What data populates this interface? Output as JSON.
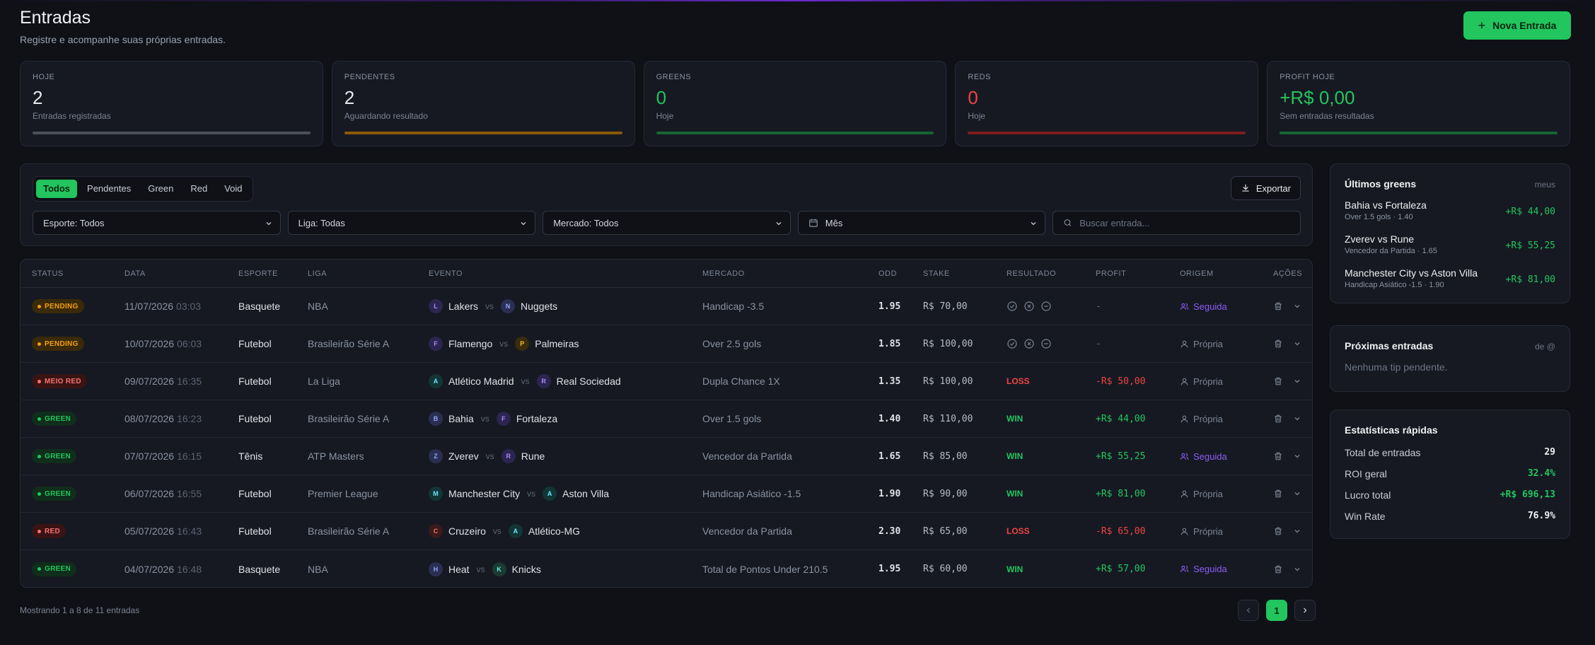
{
  "header": {
    "title": "Entradas",
    "subtitle": "Registre e acompanhe suas próprias entradas.",
    "new_button": "Nova Entrada"
  },
  "stats": [
    {
      "label": "HOJE",
      "value": "2",
      "sub": "Entradas registradas",
      "color": "#e6e8ee",
      "bar": "#4b4f5a"
    },
    {
      "label": "PENDENTES",
      "value": "2",
      "sub": "Aguardando resultado",
      "color": "#e6e8ee",
      "bar": "#8a5a08"
    },
    {
      "label": "GREENS",
      "value": "0",
      "sub": "Hoje",
      "color": "#22c55e",
      "bar": "#166534"
    },
    {
      "label": "REDS",
      "value": "0",
      "sub": "Hoje",
      "color": "#ef4444",
      "bar": "#7f1d1d"
    },
    {
      "label": "PROFIT HOJE",
      "value": "+R$ 0,00",
      "sub": "Sem entradas resultadas",
      "color": "#22c55e",
      "bar": "#166534"
    }
  ],
  "filters": {
    "tabs": [
      "Todos",
      "Pendentes",
      "Green",
      "Red",
      "Void"
    ],
    "active_tab": 0,
    "export_label": "Exportar",
    "sport": "Esporte: Todos",
    "league": "Liga: Todas",
    "market": "Mercado: Todos",
    "period": "Mês",
    "search_placeholder": "Buscar entrada..."
  },
  "table": {
    "headers": [
      "STATUS",
      "DATA",
      "ESPORTE",
      "LIGA",
      "EVENTO",
      "MERCADO",
      "ODD",
      "STAKE",
      "RESULTADO",
      "PROFIT",
      "ORIGEM",
      "AÇÕES"
    ],
    "rows": [
      {
        "status": "PENDING",
        "date": "11/07/2026",
        "time": "03:03",
        "sport": "Basquete",
        "league": "NBA",
        "home": "Lakers",
        "home_initial": "L",
        "away": "Nuggets",
        "away_initial": "N",
        "market": "Handicap -3.5",
        "odd": "1.95",
        "stake": "R$ 70,00",
        "result": "",
        "profit": "-",
        "origin": "Seguida"
      },
      {
        "status": "PENDING",
        "date": "10/07/2026",
        "time": "06:03",
        "sport": "Futebol",
        "league": "Brasileirão Série A",
        "home": "Flamengo",
        "home_initial": "F",
        "away": "Palmeiras",
        "away_initial": "P",
        "market": "Over 2.5 gols",
        "odd": "1.85",
        "stake": "R$ 100,00",
        "result": "",
        "profit": "-",
        "origin": "Própria"
      },
      {
        "status": "MEIO RED",
        "date": "09/07/2026",
        "time": "16:35",
        "sport": "Futebol",
        "league": "La Liga",
        "home": "Atlético Madrid",
        "home_initial": "A",
        "away": "Real Sociedad",
        "away_initial": "R",
        "market": "Dupla Chance 1X",
        "odd": "1.35",
        "stake": "R$ 100,00",
        "result": "LOSS",
        "profit": "-R$ 50,00",
        "origin": "Própria"
      },
      {
        "status": "GREEN",
        "date": "08/07/2026",
        "time": "16:23",
        "sport": "Futebol",
        "league": "Brasileirão Série A",
        "home": "Bahia",
        "home_initial": "B",
        "away": "Fortaleza",
        "away_initial": "F",
        "market": "Over 1.5 gols",
        "odd": "1.40",
        "stake": "R$ 110,00",
        "result": "WIN",
        "profit": "+R$ 44,00",
        "origin": "Própria"
      },
      {
        "status": "GREEN",
        "date": "07/07/2026",
        "time": "16:15",
        "sport": "Tênis",
        "league": "ATP Masters",
        "home": "Zverev",
        "home_initial": "Z",
        "away": "Rune",
        "away_initial": "R",
        "market": "Vencedor da Partida",
        "odd": "1.65",
        "stake": "R$ 85,00",
        "result": "WIN",
        "profit": "+R$ 55,25",
        "origin": "Seguida"
      },
      {
        "status": "GREEN",
        "date": "06/07/2026",
        "time": "16:55",
        "sport": "Futebol",
        "league": "Premier League",
        "home": "Manchester City",
        "home_initial": "M",
        "away": "Aston Villa",
        "away_initial": "A",
        "market": "Handicap Asiático -1.5",
        "odd": "1.90",
        "stake": "R$ 90,00",
        "result": "WIN",
        "profit": "+R$ 81,00",
        "origin": "Própria"
      },
      {
        "status": "RED",
        "date": "05/07/2026",
        "time": "16:43",
        "sport": "Futebol",
        "league": "Brasileirão Série A",
        "home": "Cruzeiro",
        "home_initial": "C",
        "away": "Atlético-MG",
        "away_initial": "A",
        "market": "Vencedor da Partida",
        "odd": "2.30",
        "stake": "R$ 65,00",
        "result": "LOSS",
        "profit": "-R$ 65,00",
        "origin": "Própria"
      },
      {
        "status": "GREEN",
        "date": "04/07/2026",
        "time": "16:48",
        "sport": "Basquete",
        "league": "NBA",
        "home": "Heat",
        "home_initial": "H",
        "away": "Knicks",
        "away_initial": "K",
        "market": "Total de Pontos Under 210.5",
        "odd": "1.95",
        "stake": "R$ 60,00",
        "result": "WIN",
        "profit": "+R$ 57,00",
        "origin": "Seguida"
      }
    ]
  },
  "pagination": {
    "showing": "Mostrando 1 a 8 de 11 entradas",
    "current": "1"
  },
  "last_greens": {
    "title": "Últimos greens",
    "tag": "meus",
    "items": [
      {
        "title": "Bahia vs Fortaleza",
        "sub": "Over 1.5 gols · 1.40",
        "value": "+R$ 44,00"
      },
      {
        "title": "Zverev vs Rune",
        "sub": "Vencedor da Partida · 1.65",
        "value": "+R$ 55,25"
      },
      {
        "title": "Manchester City vs Aston Villa",
        "sub": "Handicap Asiático -1.5 · 1.90",
        "value": "+R$ 81,00"
      }
    ]
  },
  "upcoming": {
    "title": "Próximas entradas",
    "tag": "de @",
    "empty": "Nenhuma tip pendente."
  },
  "quick_stats": {
    "title": "Estatísticas rápidas",
    "rows": [
      {
        "label": "Total de entradas",
        "value": "29",
        "color": "#f0f1f4"
      },
      {
        "label": "ROI geral",
        "value": "32.4%",
        "color": "#22c55e"
      },
      {
        "label": "Lucro total",
        "value": "+R$ 696,13",
        "color": "#22c55e"
      },
      {
        "label": "Win Rate",
        "value": "76.9%",
        "color": "#f0f1f4"
      }
    ]
  },
  "colors": {
    "accent": "#22c55e",
    "pending": "#f59e0b",
    "red": "#ef4444",
    "followed": "#8b5cf6"
  }
}
